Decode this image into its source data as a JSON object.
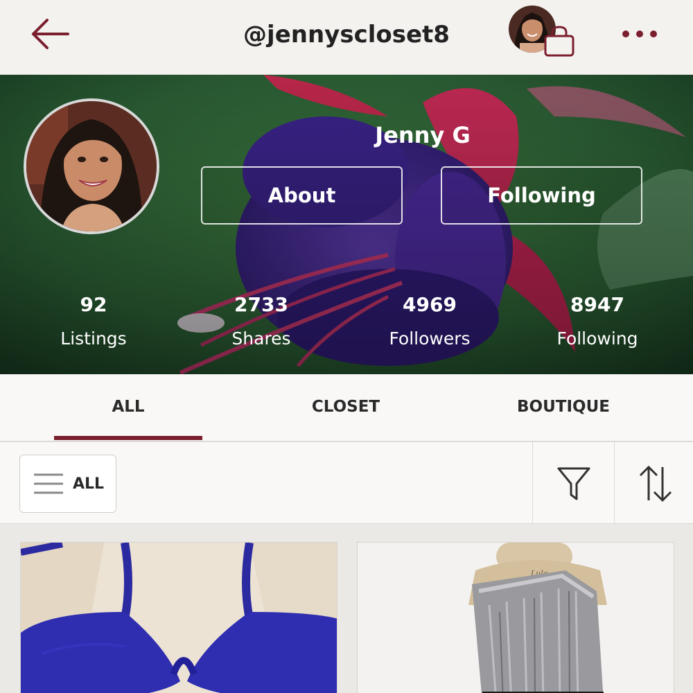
{
  "header": {
    "username": "@jennyscloset8",
    "back_icon": "back-arrow-icon",
    "bag_icon": "shopping-bag-icon",
    "more_icon": "more-dots-icon",
    "accent_color": "#7a1f2e"
  },
  "profile": {
    "name": "Jenny G",
    "about_label": "About",
    "following_button_label": "Following"
  },
  "stats": [
    {
      "value": "92",
      "label": "Listings"
    },
    {
      "value": "2733",
      "label": "Shares"
    },
    {
      "value": "4969",
      "label": "Followers"
    },
    {
      "value": "8947",
      "label": "Following"
    }
  ],
  "tabs": [
    {
      "label": "ALL",
      "active": true
    },
    {
      "label": "CLOSET",
      "active": false
    },
    {
      "label": "BOUTIQUE",
      "active": false
    }
  ],
  "filter_bar": {
    "category_label": "ALL",
    "filter_icon": "funnel-filter-icon",
    "sort_icon": "sort-arrows-icon"
  },
  "listings": [
    {
      "image": "blue-bikini-top"
    },
    {
      "image": "silver-one-shoulder-top"
    }
  ]
}
